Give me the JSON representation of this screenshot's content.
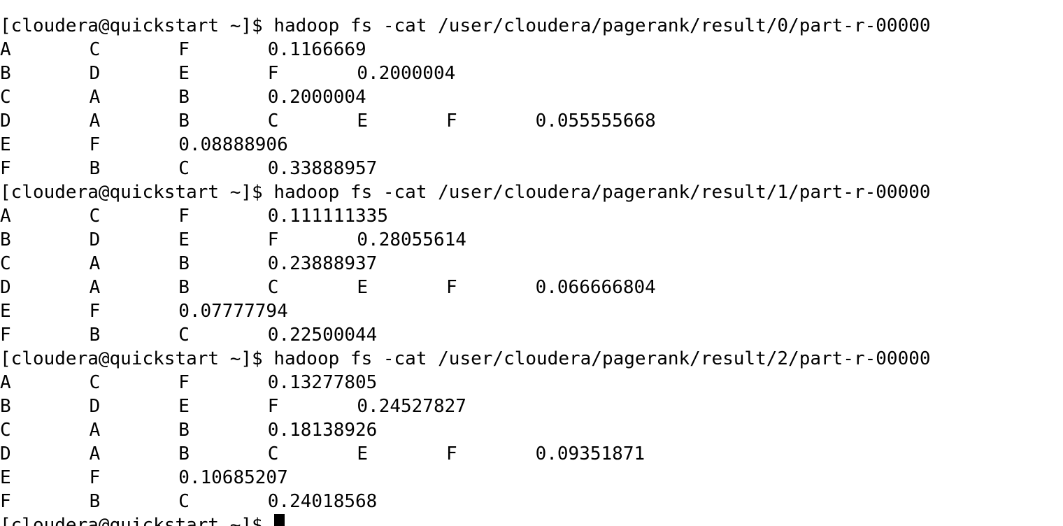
{
  "terminal": {
    "prompt": "[cloudera@quickstart ~]$",
    "blocks": [
      {
        "command": "hadoop fs -cat /user/cloudera/pagerank/result/0/part-r-00000",
        "rows": [
          [
            "A",
            "C",
            "F",
            "0.1166669"
          ],
          [
            "B",
            "D",
            "E",
            "F",
            "0.2000004"
          ],
          [
            "C",
            "A",
            "B",
            "0.2000004"
          ],
          [
            "D",
            "A",
            "B",
            "C",
            "E",
            "F",
            "0.055555668"
          ],
          [
            "E",
            "F",
            "0.08888906"
          ],
          [
            "F",
            "B",
            "C",
            "0.33888957"
          ]
        ]
      },
      {
        "command": "hadoop fs -cat /user/cloudera/pagerank/result/1/part-r-00000",
        "rows": [
          [
            "A",
            "C",
            "F",
            "0.111111335"
          ],
          [
            "B",
            "D",
            "E",
            "F",
            "0.28055614"
          ],
          [
            "C",
            "A",
            "B",
            "0.23888937"
          ],
          [
            "D",
            "A",
            "B",
            "C",
            "E",
            "F",
            "0.066666804"
          ],
          [
            "E",
            "F",
            "0.07777794"
          ],
          [
            "F",
            "B",
            "C",
            "0.22500044"
          ]
        ]
      },
      {
        "command": "hadoop fs -cat /user/cloudera/pagerank/result/2/part-r-00000",
        "rows": [
          [
            "A",
            "C",
            "F",
            "0.13277805"
          ],
          [
            "B",
            "D",
            "E",
            "F",
            "0.24527827"
          ],
          [
            "C",
            "A",
            "B",
            "0.18138926"
          ],
          [
            "D",
            "A",
            "B",
            "C",
            "E",
            "F",
            "0.09351871"
          ],
          [
            "E",
            "F",
            "0.10685207"
          ],
          [
            "F",
            "B",
            "C",
            "0.24018568"
          ]
        ]
      }
    ],
    "final_prompt": "[cloudera@quickstart ~]$"
  }
}
